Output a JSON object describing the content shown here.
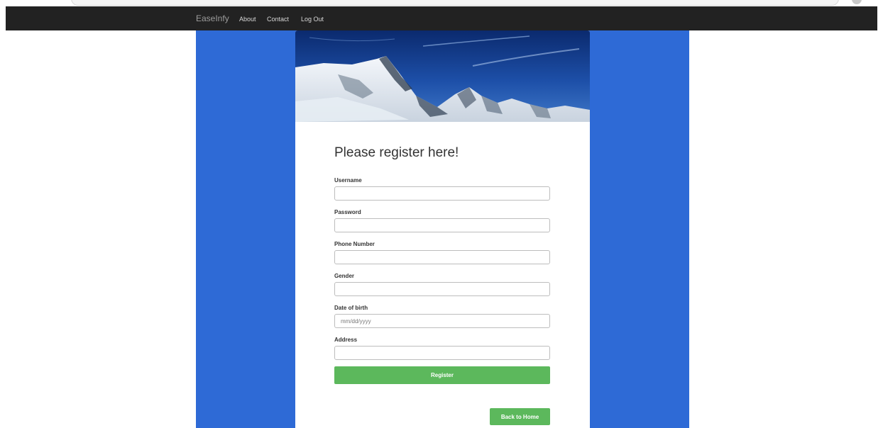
{
  "navbar": {
    "brand": "EaseInfy",
    "links": [
      {
        "label": "About"
      },
      {
        "label": "Contact"
      },
      {
        "label": "Log Out"
      }
    ]
  },
  "form": {
    "title": "Please register here!",
    "fields": [
      {
        "label": "Username",
        "value": "",
        "placeholder": ""
      },
      {
        "label": "Password",
        "value": "",
        "placeholder": ""
      },
      {
        "label": "Phone Number",
        "value": "",
        "placeholder": ""
      },
      {
        "label": "Gender",
        "value": "",
        "placeholder": ""
      },
      {
        "label": "Date of birth",
        "value": "",
        "placeholder": "mm/dd/yyyy"
      },
      {
        "label": "Address",
        "value": "",
        "placeholder": ""
      }
    ],
    "register_label": "Register",
    "back_label": "Back to Home"
  },
  "colors": {
    "navbar_bg": "#222222",
    "page_blue": "#2e6ad6",
    "button_green": "#5cb85c"
  }
}
